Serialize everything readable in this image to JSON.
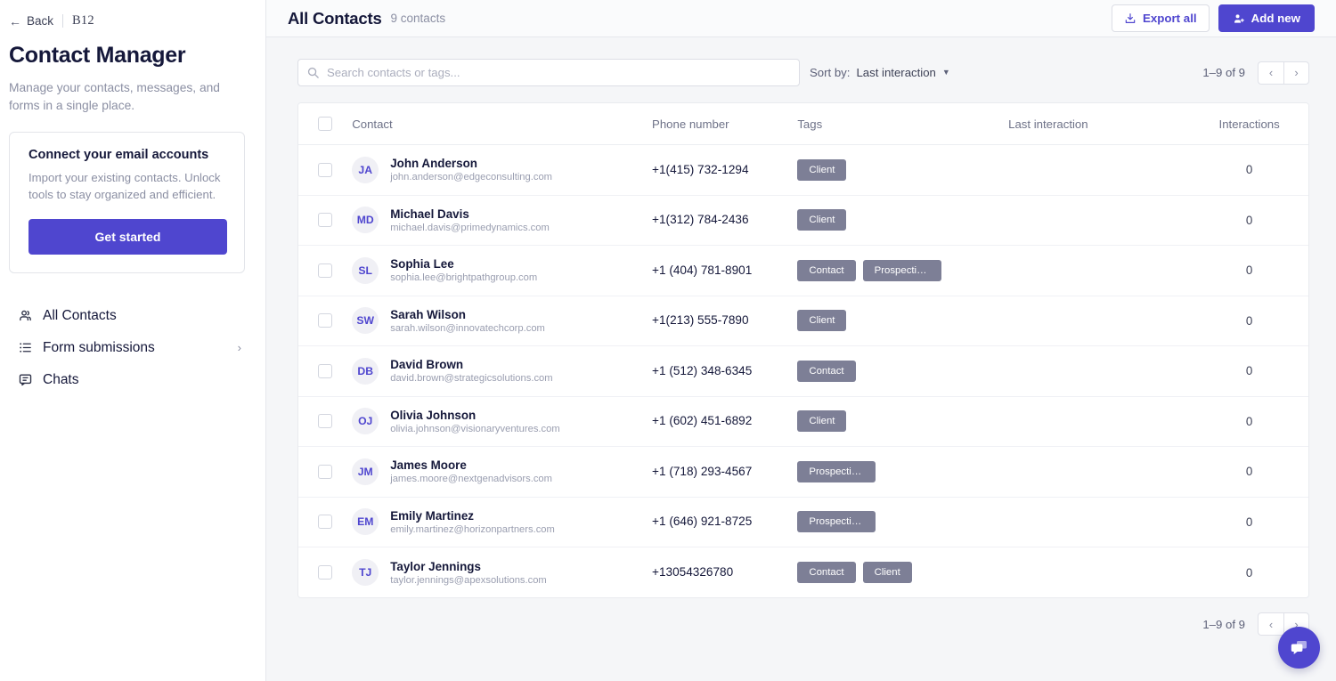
{
  "sidebar": {
    "back_label": "Back",
    "brand": "B12",
    "title": "Contact Manager",
    "subtitle": "Manage your contacts, messages, and forms in a single place.",
    "promo": {
      "title": "Connect your email accounts",
      "text": "Import your existing contacts. Unlock tools to stay organized and efficient.",
      "cta": "Get started"
    },
    "nav": [
      {
        "label": "All Contacts",
        "icon": "people-icon",
        "chevron": ""
      },
      {
        "label": "Form submissions",
        "icon": "list-icon",
        "chevron": "›"
      },
      {
        "label": "Chats",
        "icon": "chat-icon",
        "chevron": ""
      }
    ]
  },
  "header": {
    "title": "All Contacts",
    "count": "9 contacts",
    "export_label": "Export all",
    "add_label": "Add new"
  },
  "toolbar": {
    "search_placeholder": "Search contacts or tags...",
    "search_value": "",
    "sort_label": "Sort by:",
    "sort_value": "Last interaction",
    "pager_text": "1–9 of 9",
    "prev": "‹",
    "next": "›"
  },
  "table": {
    "columns": [
      "Contact",
      "Phone number",
      "Tags",
      "Last interaction",
      "Interactions"
    ],
    "rows": [
      {
        "initials": "JA",
        "name": "John Anderson",
        "email": "john.anderson@edgeconsulting.com",
        "phone": "+1(415) 732-1294",
        "tags": [
          "Client"
        ],
        "last_interaction": "",
        "interactions": "0"
      },
      {
        "initials": "MD",
        "name": "Michael Davis",
        "email": "michael.davis@primedynamics.com",
        "phone": "+1(312) 784-2436",
        "tags": [
          "Client"
        ],
        "last_interaction": "",
        "interactions": "0"
      },
      {
        "initials": "SL",
        "name": "Sophia Lee",
        "email": "sophia.lee@brightpathgroup.com",
        "phone": "+1 (404) 781-8901",
        "tags": [
          "Contact",
          "Prospectiv…"
        ],
        "last_interaction": "",
        "interactions": "0"
      },
      {
        "initials": "SW",
        "name": "Sarah Wilson",
        "email": "sarah.wilson@innovatechcorp.com",
        "phone": "+1(213) 555-7890",
        "tags": [
          "Client"
        ],
        "last_interaction": "",
        "interactions": "0"
      },
      {
        "initials": "DB",
        "name": "David Brown",
        "email": "david.brown@strategicsolutions.com",
        "phone": "+1 (512) 348-6345",
        "tags": [
          "Contact"
        ],
        "last_interaction": "",
        "interactions": "0"
      },
      {
        "initials": "OJ",
        "name": "Olivia Johnson",
        "email": "olivia.johnson@visionaryventures.com",
        "phone": "+1 (602) 451-6892",
        "tags": [
          "Client"
        ],
        "last_interaction": "",
        "interactions": "0"
      },
      {
        "initials": "JM",
        "name": "James Moore",
        "email": "james.moore@nextgenadvisors.com",
        "phone": "+1 (718) 293-4567",
        "tags": [
          "Prospectiv…"
        ],
        "last_interaction": "",
        "interactions": "0"
      },
      {
        "initials": "EM",
        "name": "Emily Martinez",
        "email": "emily.martinez@horizonpartners.com",
        "phone": "+1 (646) 921-8725",
        "tags": [
          "Prospectiv…"
        ],
        "last_interaction": "",
        "interactions": "0"
      },
      {
        "initials": "TJ",
        "name": "Taylor Jennings",
        "email": "taylor.jennings@apexsolutions.com",
        "phone": "+13054326780",
        "tags": [
          "Contact",
          "Client"
        ],
        "last_interaction": "",
        "interactions": "0"
      }
    ]
  },
  "footer": {
    "pager_text": "1–9 of 9",
    "prev": "‹",
    "next": "›"
  },
  "colors": {
    "accent": "#4f46cf",
    "tag": "#7d7f96",
    "page_bg": "#f5f6f8",
    "text": "#15183a",
    "muted": "#8b8fa3"
  }
}
